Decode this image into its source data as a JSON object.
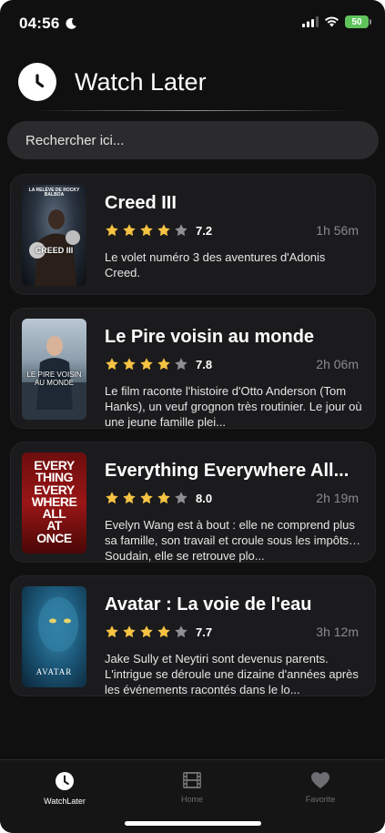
{
  "status_bar": {
    "time": "04:56",
    "battery": "50"
  },
  "header": {
    "title": "Watch Later"
  },
  "search": {
    "placeholder": "Rechercher ici..."
  },
  "movies": [
    {
      "title": "Creed III",
      "rating": "7.2",
      "stars_filled": 4,
      "duration": "1h 56m",
      "description": "Le volet numéro 3 des aventures d'Adonis Creed.",
      "poster_text": "CREED III",
      "poster_tagline": "LA RELÈVE DE ROCKY BALBOA"
    },
    {
      "title": "Le Pire voisin au monde",
      "rating": "7.8",
      "stars_filled": 4,
      "duration": "2h 06m",
      "description": "Le film raconte l'histoire d'Otto Anderson (Tom Hanks), un veuf grognon très routinier. Le jour où une jeune famille plei...",
      "poster_text": "LE PIRE VOISIN AU MONDE"
    },
    {
      "title": "Everything Everywhere All...",
      "rating": "8.0",
      "stars_filled": 4,
      "duration": "2h 19m",
      "description": "Evelyn Wang est à bout : elle ne comprend plus sa famille, son travail et croule sous les impôts… Soudain, elle se retrouve plo...",
      "poster_text": "EVERY THING EVERY WHERE ALL AT ONCE"
    },
    {
      "title": "Avatar : La voie de l'eau",
      "rating": "7.7",
      "stars_filled": 4,
      "duration": "3h 12m",
      "description": "Jake Sully et Neytiri sont devenus parents. L'intrigue se déroule une dizaine d'années après les événements racontés dans le lo...",
      "poster_text": "AVATAR"
    }
  ],
  "tabs": [
    {
      "label": "WatchLater",
      "icon": "clock-icon",
      "active": true
    },
    {
      "label": "Home",
      "icon": "film-icon",
      "active": false
    },
    {
      "label": "Favorite",
      "icon": "heart-icon",
      "active": false
    }
  ],
  "colors": {
    "background": "#101010",
    "card": "#1b1b1d",
    "star": "#f6c343",
    "star_empty": "#8e8e93",
    "active_tab": "#ffffff",
    "inactive_tab": "#6e6e72"
  }
}
